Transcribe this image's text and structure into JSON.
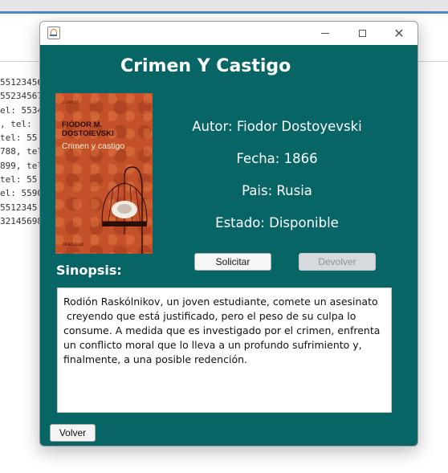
{
  "background": {
    "lines": [
      "55123456",
      "55234567",
      "el: 5534",
      ", tel: ",
      "tel: 55",
      "788, tel",
      "899, tel",
      "tel: 55",
      "el: 5590",
      "5512345",
      "32145698"
    ]
  },
  "window": {
    "icon": "java-icon",
    "controls": [
      "minimize-icon",
      "maximize-icon",
      "close-icon"
    ],
    "close_glyph": "✕"
  },
  "book": {
    "title": "Crimen Y Castigo",
    "author_line": "Autor: Fiodor Dostoyevski",
    "date_line": "Fecha: 1866",
    "country_line": "Pais: Rusia",
    "status_line": "Estado: Disponible",
    "cover": {
      "publisher_top": "CLÁSICOS",
      "author": "FIÓDOR M. DOSTOIEVSKI",
      "book_title": "Crimen y castigo",
      "publisher_bottom": "DEBOLSILLO"
    }
  },
  "buttons": {
    "request": "Solicitar",
    "return": "Devolver",
    "back": "Volver"
  },
  "synopsis": {
    "label": "Sinopsis:",
    "text": "Rodión Raskólnikov, un joven estudiante, comete un asesinato\n creyendo que está justificado, pero el peso de su culpa lo\nconsume. A medida que es investigado por el crimen, enfrenta\nun conflicto moral que lo lleva a un profundo sufrimiento y,\nfinalmente, a una posible redención."
  },
  "colors": {
    "panel_bg": "#076565",
    "cover_bg": "#c4512a"
  }
}
